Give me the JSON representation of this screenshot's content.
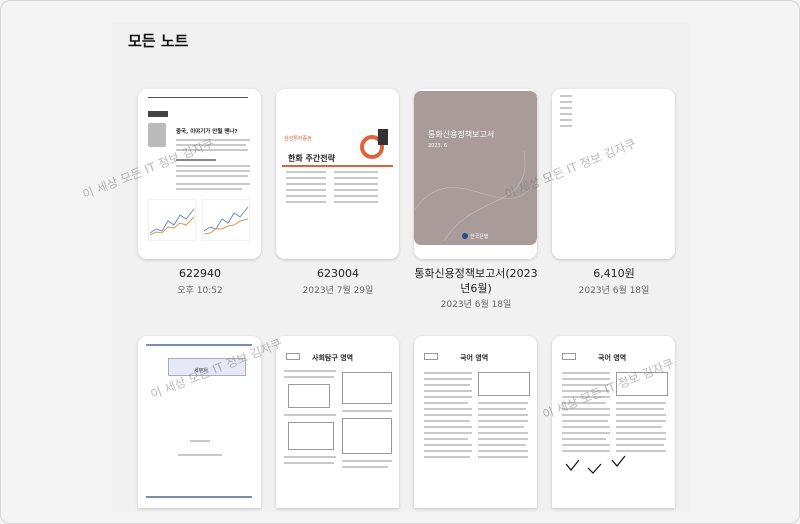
{
  "header": {
    "title": "모든 노트"
  },
  "notes": [
    {
      "name": "622940",
      "date": "오후 10:52",
      "thumb": {
        "heading": "중국, 이야기가 안될 땐나?"
      }
    },
    {
      "name": "623004",
      "date": "2023년 7월 29일",
      "thumb": {
        "brand": "삼성투자증권",
        "title": "한화 주간전략"
      }
    },
    {
      "name": "통화신용정책보고서(2023년6월)",
      "date": "2023년 6월 18일",
      "thumb": {
        "title": "통화신용정책보고서",
        "sub": "2023. 6",
        "org": "한국은행"
      }
    },
    {
      "name": "6,410원",
      "date": "2023년 6월 18일"
    },
    {
      "thumb": {
        "sub": "세무서"
      }
    },
    {
      "thumb": {
        "title": "사회탐구 영역"
      }
    },
    {
      "thumb": {
        "title": "국어 영역"
      }
    },
    {
      "thumb": {
        "title": "국어 영역"
      }
    }
  ],
  "watermark": {
    "text": "이 세상 모든 IT 정보 김자쿠"
  },
  "colors": {
    "report_cover": "#a89b9a",
    "accent_orange": "#e0623a",
    "background": "#f4f4f4"
  }
}
